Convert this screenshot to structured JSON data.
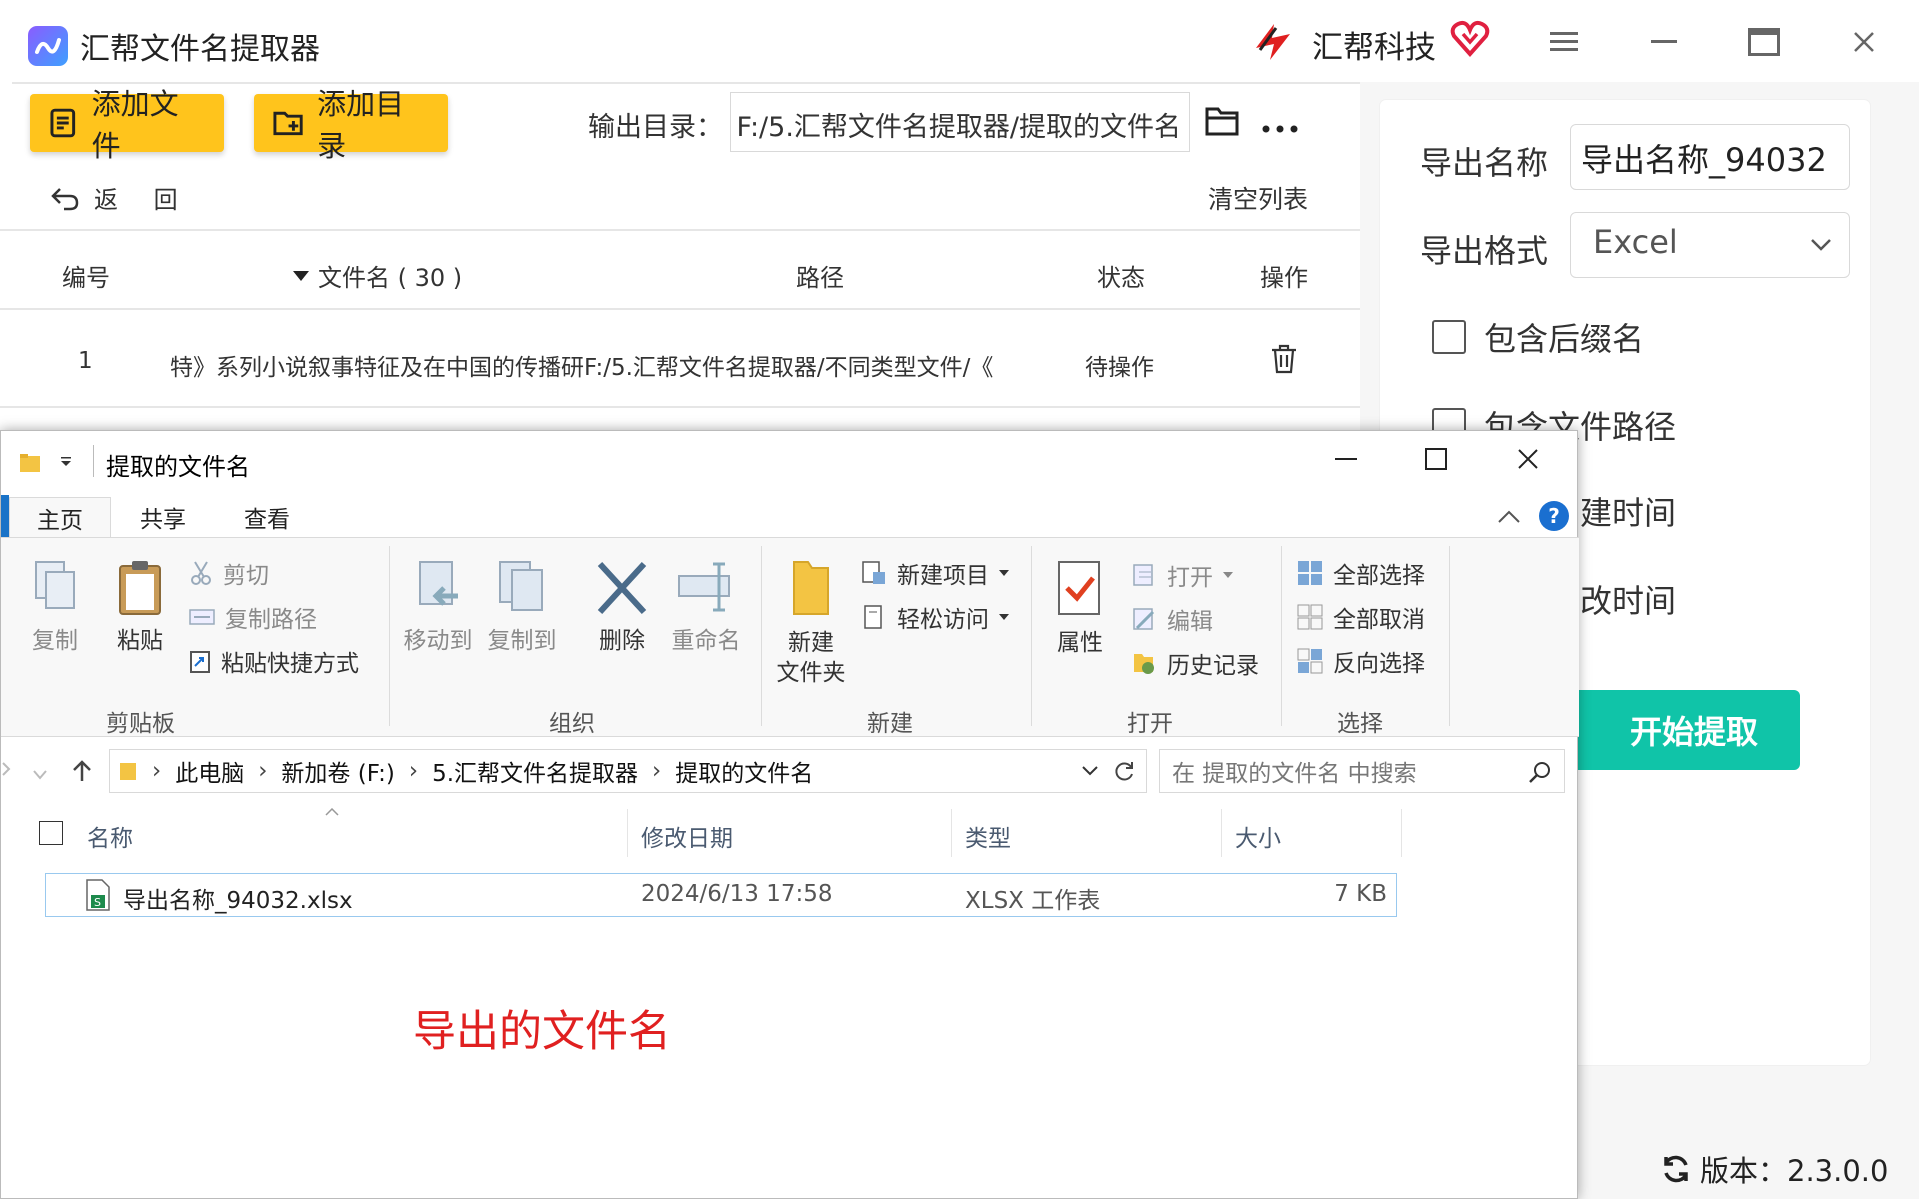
{
  "app": {
    "title": "汇帮文件名提取器",
    "brand": "汇帮科技",
    "buttons": {
      "add_file": "添加文件",
      "add_folder": "添加目录"
    },
    "output_label": "输出目录：",
    "output_value": "F:/5.汇帮文件名提取器/提取的文件名",
    "back_label": "返 回",
    "clear_list": "清空列表",
    "table": {
      "headers": {
        "index": "编号",
        "filename": "文件名 ( 30 )",
        "path": "路径",
        "status": "状态",
        "action": "操作"
      },
      "rows": [
        {
          "index": "1",
          "name_path": "特》系列小说叙事特征及在中国的传播研F:/5.汇帮文件名提取器/不同类型文件/《",
          "status": "待操作"
        }
      ]
    },
    "right_panel": {
      "export_name_label": "导出名称",
      "export_name_value": "导出名称_94032",
      "export_format_label": "导出格式",
      "export_format_value": "Excel",
      "options": [
        "包含后缀名",
        "包含文件路径",
        "建时间",
        "改时间"
      ],
      "start_button": "开始提取"
    },
    "version": "版本：2.3.0.0",
    "colors": {
      "accent_yellow": "#ffc41c",
      "start_green": "#10c4a8"
    }
  },
  "explorer": {
    "title": "提取的文件名",
    "tabs": [
      "主页",
      "共享",
      "查看"
    ],
    "ribbon": {
      "clipboard": {
        "copy": "复制",
        "paste": "粘贴",
        "cut": "剪切",
        "copy_path": "复制路径",
        "paste_shortcut": "粘贴快捷方式",
        "group": "剪贴板"
      },
      "organize": {
        "move_to": "移动到",
        "copy_to": "复制到",
        "delete": "删除",
        "rename": "重命名",
        "group": "组织"
      },
      "new": {
        "new_folder_1": "新建",
        "new_folder_2": "文件夹",
        "new_item": "新建项目",
        "easy_access": "轻松访问",
        "group": "新建"
      },
      "open": {
        "properties": "属性",
        "open": "打开",
        "edit": "编辑",
        "history": "历史记录",
        "group": "打开"
      },
      "select": {
        "select_all": "全部选择",
        "select_none": "全部取消",
        "invert": "反向选择",
        "group": "选择"
      }
    },
    "breadcrumb": [
      "此电脑",
      "新加卷 (F:)",
      "5.汇帮文件名提取器",
      "提取的文件名"
    ],
    "search_placeholder": "在 提取的文件名 中搜索",
    "columns": {
      "name": "名称",
      "modified": "修改日期",
      "type": "类型",
      "size": "大小"
    },
    "files": [
      {
        "name": "导出名称_94032.xlsx",
        "modified": "2024/6/13 17:58",
        "type": "XLSX 工作表",
        "size": "7 KB"
      }
    ],
    "note": "导出的文件名"
  }
}
